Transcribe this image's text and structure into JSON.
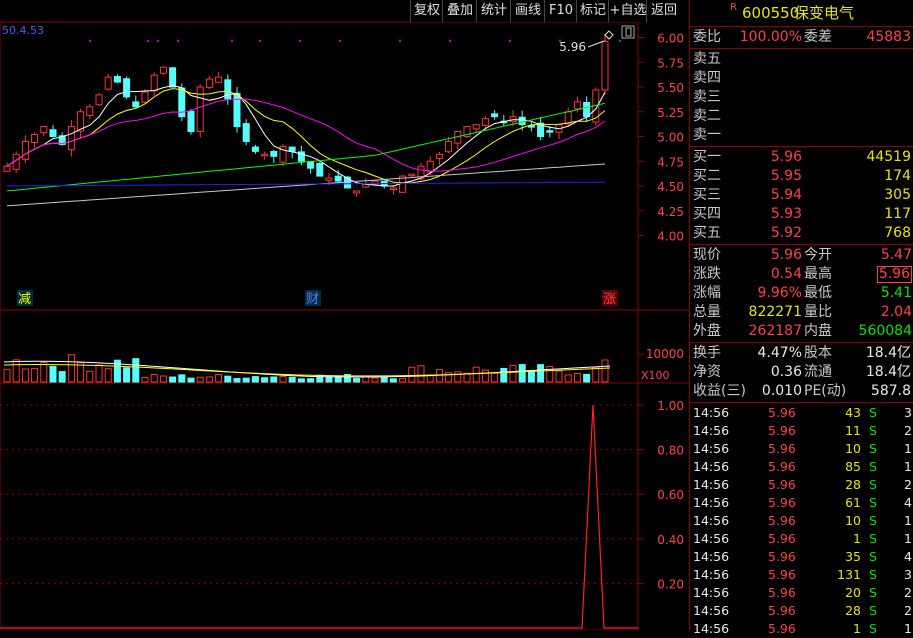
{
  "toolbar": [
    "复权",
    "叠加",
    "统计",
    "画线",
    "F10",
    "标记",
    "+自选",
    "返回"
  ],
  "chart": {
    "ma_readout": "50.4.53",
    "price_ticks": [
      "6.00",
      "5.75",
      "5.50",
      "5.25",
      "5.00",
      "4.75",
      "4.50",
      "4.25",
      "4.00"
    ],
    "last_price_label": "5.96",
    "markers": [
      "减",
      "财",
      "涨"
    ],
    "volume_tick": "10000",
    "volume_unit": "X100",
    "indicator_ticks": [
      "1.00",
      "0.80",
      "0.60",
      "0.40",
      "0.20"
    ],
    "colors": {
      "up": "#ff3333",
      "down": "#54ffff",
      "ma5": "#ffffff",
      "ma10": "#ffff00",
      "ma20": "#ff00ff",
      "ma30": "#00ff00",
      "ma60": "#c8c8c8",
      "ma120": "#2020ff"
    }
  },
  "stock": {
    "badge": "R",
    "code": "600550",
    "name": "保变电气"
  },
  "quote": {
    "weibi_label": "委比",
    "weibi_value": "100.00%",
    "weicha_label": "委差",
    "weicha_value": "45883",
    "asks": [
      "卖五",
      "卖四",
      "卖三",
      "卖二",
      "卖一"
    ],
    "bids": [
      {
        "label": "买一",
        "price": "5.96",
        "vol": "44519"
      },
      {
        "label": "买二",
        "price": "5.95",
        "vol": "174"
      },
      {
        "label": "买三",
        "price": "5.94",
        "vol": "305"
      },
      {
        "label": "买四",
        "price": "5.93",
        "vol": "117"
      },
      {
        "label": "买五",
        "price": "5.92",
        "vol": "768"
      }
    ],
    "stats": [
      {
        "l1": "现价",
        "v1": "5.96",
        "l2": "今开",
        "v2": "5.47",
        "c1": "red",
        "c2": "red",
        "b2": false
      },
      {
        "l1": "涨跌",
        "v1": "0.54",
        "l2": "最高",
        "v2": "5.96",
        "c1": "red",
        "c2": "red",
        "b2": true
      },
      {
        "l1": "涨幅",
        "v1": "9.96%",
        "l2": "最低",
        "v2": "5.41",
        "c1": "red",
        "c2": "grn",
        "b2": false
      },
      {
        "l1": "总量",
        "v1": "822271",
        "l2": "量比",
        "v2": "2.04",
        "c1": "yel",
        "c2": "red",
        "b2": false
      },
      {
        "l1": "外盘",
        "v1": "262187",
        "l2": "内盘",
        "v2": "560084",
        "c1": "red",
        "c2": "grn",
        "b2": false
      }
    ],
    "stats2": [
      {
        "l1": "换手",
        "v1": "4.47%",
        "l2": "股本",
        "v2": "18.4亿"
      },
      {
        "l1": "净资",
        "v1": "0.36",
        "l2": "流通",
        "v2": "18.4亿"
      },
      {
        "l1": "收益(三)",
        "v1": "0.010",
        "l2": "PE(动)",
        "v2": "587.8"
      }
    ],
    "ticks": [
      {
        "t": "14:56",
        "p": "5.96",
        "v": "43",
        "s": "S",
        "n": "3"
      },
      {
        "t": "14:56",
        "p": "5.96",
        "v": "11",
        "s": "S",
        "n": "2"
      },
      {
        "t": "14:56",
        "p": "5.96",
        "v": "10",
        "s": "S",
        "n": "1"
      },
      {
        "t": "14:56",
        "p": "5.96",
        "v": "85",
        "s": "S",
        "n": "1"
      },
      {
        "t": "14:56",
        "p": "5.96",
        "v": "28",
        "s": "S",
        "n": "2"
      },
      {
        "t": "14:56",
        "p": "5.96",
        "v": "61",
        "s": "S",
        "n": "4"
      },
      {
        "t": "14:56",
        "p": "5.96",
        "v": "10",
        "s": "S",
        "n": "1"
      },
      {
        "t": "14:56",
        "p": "5.96",
        "v": "1",
        "s": "S",
        "n": "1"
      },
      {
        "t": "14:56",
        "p": "5.96",
        "v": "35",
        "s": "S",
        "n": "4"
      },
      {
        "t": "14:56",
        "p": "5.96",
        "v": "131",
        "s": "S",
        "n": "3"
      },
      {
        "t": "14:56",
        "p": "5.96",
        "v": "20",
        "s": "S",
        "n": "2"
      },
      {
        "t": "14:56",
        "p": "5.96",
        "v": "28",
        "s": "S",
        "n": "2"
      },
      {
        "t": "14:56",
        "p": "5.96",
        "v": "1",
        "s": "S",
        "n": "1"
      }
    ]
  }
}
